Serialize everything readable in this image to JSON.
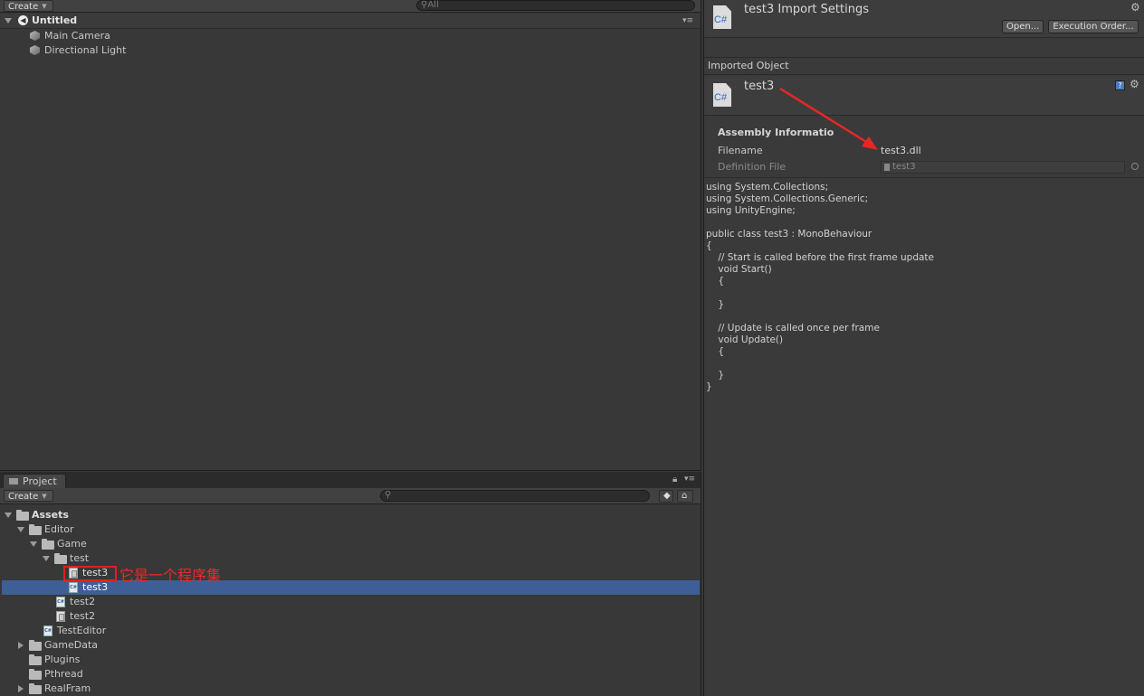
{
  "hierarchy": {
    "create_label": "Create",
    "search_placeholder": "All",
    "scene_name": "Untitled",
    "items": [
      "Main Camera",
      "Directional Light"
    ]
  },
  "project": {
    "tab_label": "Project",
    "create_label": "Create",
    "tree": {
      "assets": "Assets",
      "editor": "Editor",
      "game": "Game",
      "test": "test",
      "test3_dll": "test3",
      "test3_cs": "test3",
      "test2_cs": "test2",
      "test2_dll": "test2",
      "test_editor": "TestEditor",
      "game_data": "GameData",
      "plugins": "Plugins",
      "pthread": "Pthread",
      "real_fram": "RealFram"
    },
    "annotation": "它是一个程序集"
  },
  "inspector": {
    "title": "test3 Import Settings",
    "open_button": "Open...",
    "exec_order_button": "Execution Order...",
    "imported_object_label": "Imported Object",
    "object_name": "test3",
    "icon_glyph": "C#",
    "assembly_heading": "Assembly Informatio",
    "filename_label": "Filename",
    "filename_value": "test3.dll",
    "definition_label": "Definition File",
    "definition_value": "test3",
    "code": "using System.Collections;\nusing System.Collections.Generic;\nusing UnityEngine;\n\npublic class test3 : MonoBehaviour\n{\n    // Start is called before the first frame update\n    void Start()\n    {\n\n    }\n\n    // Update is called once per frame\n    void Update()\n    {\n\n    }\n}"
  },
  "colors": {
    "selection": "#3e5f96",
    "annotation": "#f02828",
    "cs_icon_text": "#2a6bc8"
  }
}
